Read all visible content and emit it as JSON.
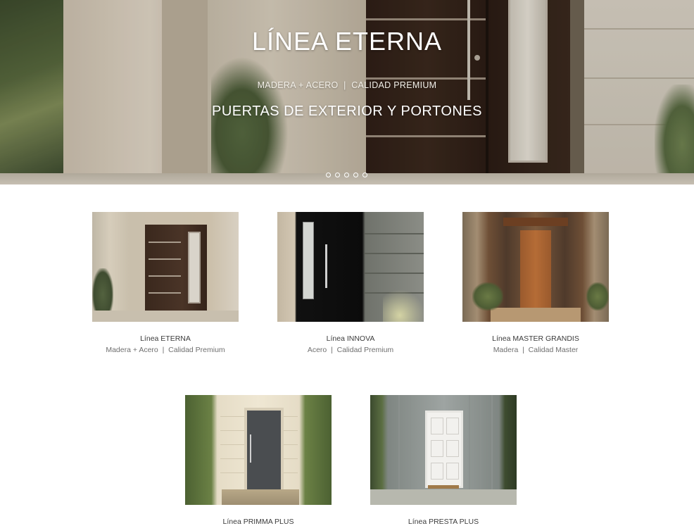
{
  "hero": {
    "title": "LÍNEA ETERNA",
    "subtitle": "MADERA + ACERO  |  CALIDAD PREMIUM",
    "tagline": "PUERTAS DE EXTERIOR Y PORTONES",
    "slide_count": 5,
    "active_slide": 1
  },
  "products": [
    {
      "name": "Línea ETERNA",
      "desc": "Madera + Acero  |  Calidad Premium"
    },
    {
      "name": "Línea INNOVA",
      "desc": "Acero  |  Calidad Premium"
    },
    {
      "name": "Línea MASTER GRANDIS",
      "desc": "Madera  |  Calidad Master"
    },
    {
      "name": "Línea PRIMMA PLUS",
      "desc": ""
    },
    {
      "name": "Línea PRESTA PLUS",
      "desc": ""
    }
  ]
}
